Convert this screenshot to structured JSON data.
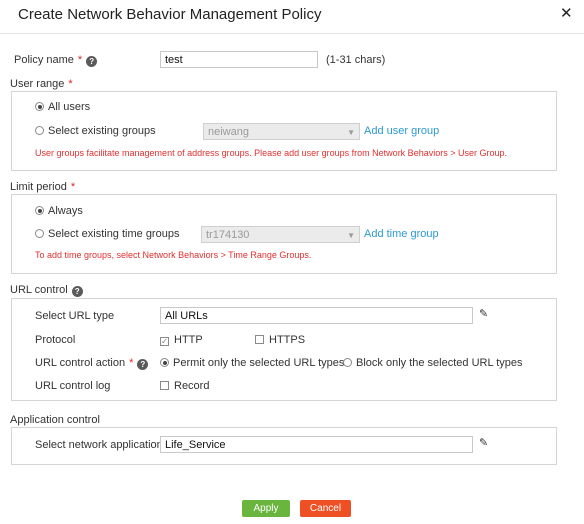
{
  "dialog": {
    "title": "Create Network Behavior Management Policy"
  },
  "policy_name": {
    "label": "Policy name",
    "value": "test",
    "hint": "(1-31 chars)"
  },
  "user_range": {
    "label": "User range",
    "all_users_label": "All users",
    "select_groups_label": "Select existing groups",
    "group_selected": "neiwang",
    "add_link": "Add user group",
    "note": "User groups facilitate management of address groups. Please add user groups from Network Behaviors > User Group."
  },
  "limit_period": {
    "label": "Limit period",
    "always_label": "Always",
    "select_groups_label": "Select existing time groups",
    "group_selected": "tr174130",
    "add_link": "Add time group",
    "note": "To add time groups, select Network Behaviors > Time Range Groups."
  },
  "url_control": {
    "label": "URL control",
    "url_type_label": "Select URL type",
    "url_type_value": "All URLs",
    "protocol_label": "Protocol",
    "http_label": "HTTP",
    "https_label": "HTTPS",
    "action_label": "URL control action",
    "permit_label": "Permit only the selected URL types",
    "block_label": "Block only the selected URL types",
    "log_label": "URL control log",
    "record_label": "Record"
  },
  "app_control": {
    "label": "Application control",
    "select_apps_label": "Select network applications",
    "apps_value": "Life_Service"
  },
  "buttons": {
    "apply": "Apply",
    "cancel": "Cancel"
  },
  "colors": {
    "apply": "#6ab53e",
    "cancel": "#ee5024",
    "link": "#2b9ad4",
    "required": "#e02020"
  }
}
